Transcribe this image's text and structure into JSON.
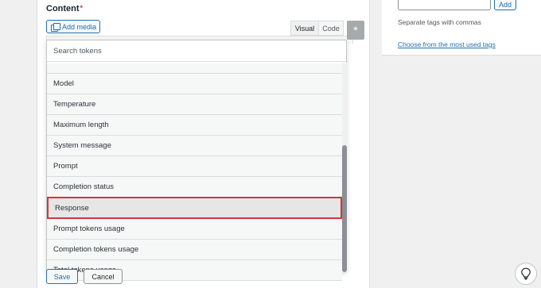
{
  "editor": {
    "content_label": "Content",
    "required_mark": "*",
    "add_media_label": "Add media",
    "tab_visual": "Visual",
    "tab_code": "Code",
    "token_button_label": "*"
  },
  "token_dropdown": {
    "search_placeholder": "Search tokens",
    "items": [
      {
        "label": "Model"
      },
      {
        "label": "Temperature"
      },
      {
        "label": "Maximum length"
      },
      {
        "label": "System message"
      },
      {
        "label": "Prompt"
      },
      {
        "label": "Completion status"
      },
      {
        "label": "Response",
        "highlighted": true
      },
      {
        "label": "Prompt tokens usage"
      },
      {
        "label": "Completion tokens usage"
      },
      {
        "label": "Total tokens usage"
      }
    ]
  },
  "actions": {
    "save_label": "Save",
    "cancel_label": "Cancel"
  },
  "tags": {
    "add_label": "Add",
    "hint": "Separate tags with commas",
    "most_used_link": "Choose from the most used tags"
  },
  "colors": {
    "accent": "#2271b1",
    "highlight_border": "#d63638"
  },
  "icons": {
    "add_media": "media-icon",
    "help": "lightbulb-icon"
  }
}
